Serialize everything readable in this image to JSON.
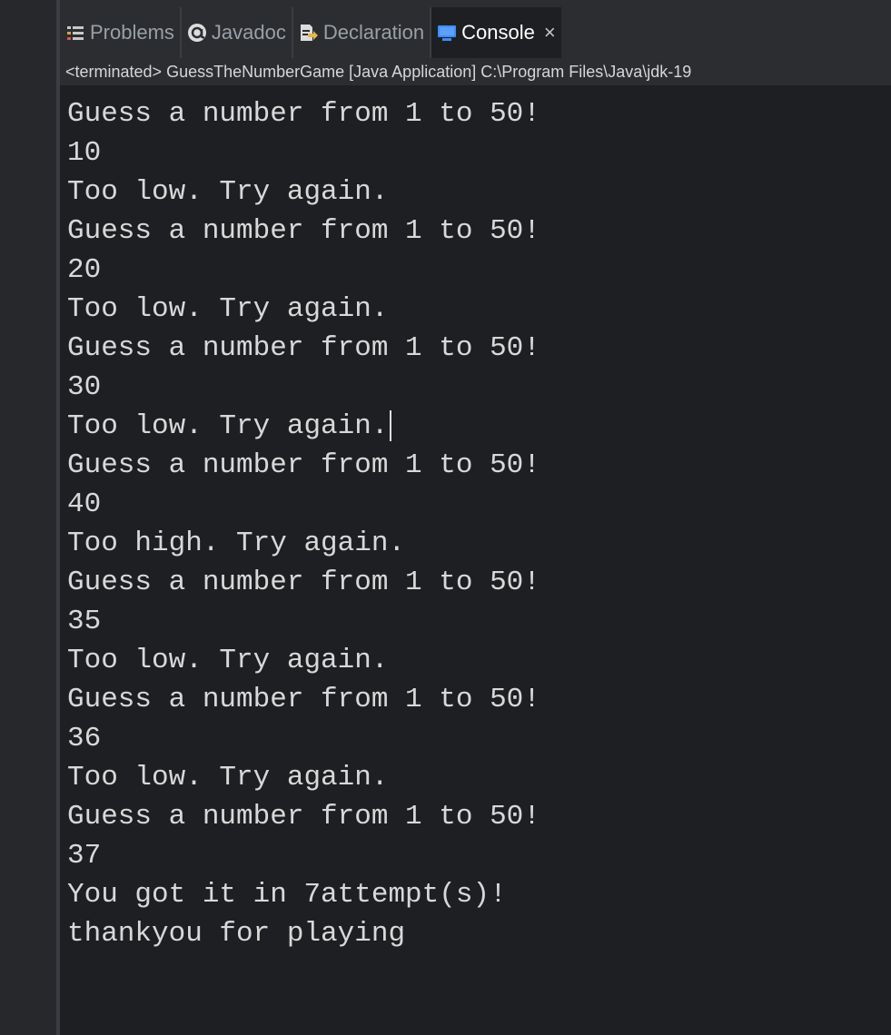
{
  "tabs": [
    {
      "label": "Problems",
      "icon": "problems-icon",
      "active": false
    },
    {
      "label": "Javadoc",
      "icon": "javadoc-icon",
      "active": false
    },
    {
      "label": "Declaration",
      "icon": "declaration-icon",
      "active": false
    },
    {
      "label": "Console",
      "icon": "console-icon",
      "active": true
    }
  ],
  "status": {
    "text": "<terminated> GuessTheNumberGame [Java Application] C:\\Program Files\\Java\\jdk-19"
  },
  "console": {
    "lines": [
      "Guess a number from 1 to 50!",
      "10",
      "Too low. Try again.",
      "Guess a number from 1 to 50!",
      "20",
      "Too low. Try again.",
      "Guess a number from 1 to 50!",
      "30",
      "Too low. Try again.",
      "Guess a number from 1 to 50!",
      "40",
      "Too high. Try again.",
      "Guess a number from 1 to 50!",
      "35",
      "Too low. Try again.",
      "Guess a number from 1 to 50!",
      "36",
      "Too low. Try again.",
      "Guess a number from 1 to 50!",
      "37",
      "You got it in 7attempt(s)!",
      "thankyou for playing"
    ],
    "caret_line": 8
  },
  "colors": {
    "background": "#1e1f22",
    "tabbar": "#2b2d30",
    "text": "#d8d8d8",
    "console_icon": "#3f8cff"
  }
}
